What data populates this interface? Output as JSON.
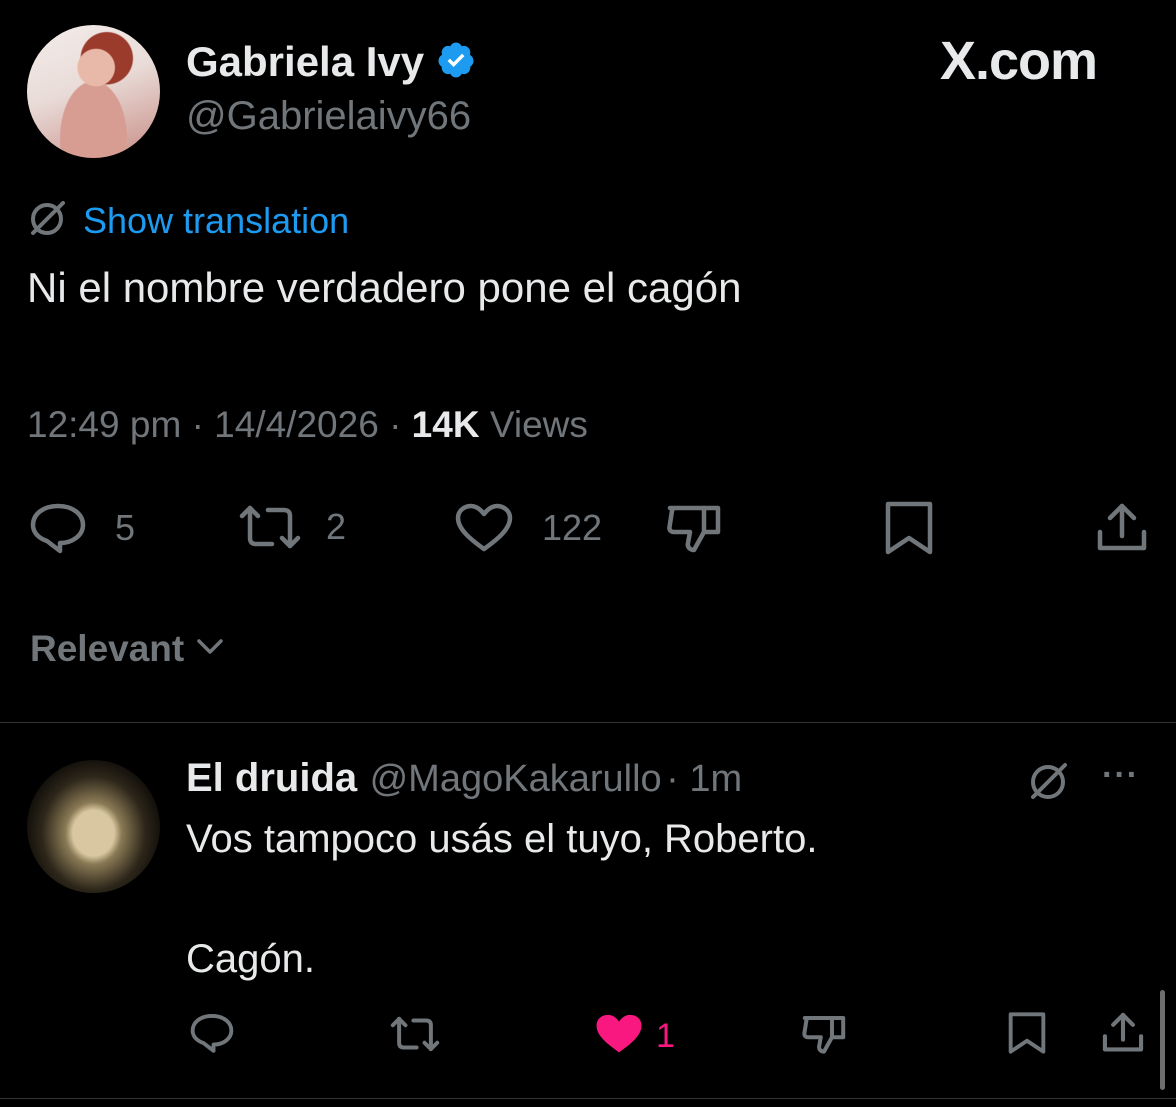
{
  "brand": {
    "logo_text": "X.com"
  },
  "tweet": {
    "author_name": "Gabriela Ivy",
    "author_handle": "@Gabrielaivy66",
    "verified": true,
    "translate_label": "Show translation",
    "text": "Ni el nombre verdadero pone el cagón",
    "time": "12:49 pm",
    "date": "14/4/2026",
    "views_count": "14K",
    "views_label": "Views",
    "sep": "·",
    "replies": "5",
    "reposts": "2",
    "likes": "122"
  },
  "sort": {
    "label": "Relevant"
  },
  "reply": {
    "author_name": "El druida",
    "author_handle": "@MagoKakarullo",
    "time": "· 1m",
    "line1": "Vos tampoco usás el tuyo, Roberto.",
    "line2": "Cagón.",
    "likes": "1",
    "more": "···"
  },
  "colors": {
    "background": "#000000",
    "text": "#e7e9ea",
    "secondary": "#71767b",
    "link": "#1d9bf0",
    "like_active": "#f91880",
    "verified": "#1d9bf0"
  }
}
